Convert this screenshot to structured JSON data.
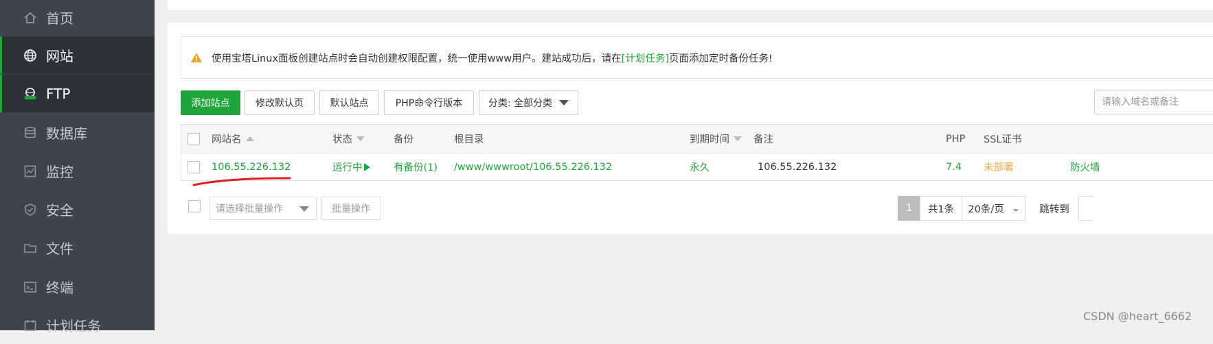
{
  "sidebar": {
    "items": [
      {
        "label": "首页",
        "icon": "home-icon",
        "active": false
      },
      {
        "label": "网站",
        "icon": "globe-icon",
        "active": true
      },
      {
        "label": "FTP",
        "icon": "ftp-icon",
        "active": true
      },
      {
        "label": "数据库",
        "icon": "database-icon",
        "active": false
      },
      {
        "label": "监控",
        "icon": "monitor-icon",
        "active": false
      },
      {
        "label": "安全",
        "icon": "shield-icon",
        "active": false
      },
      {
        "label": "文件",
        "icon": "folder-icon",
        "active": false
      },
      {
        "label": "终端",
        "icon": "terminal-icon",
        "active": false
      },
      {
        "label": "计划任务",
        "icon": "calendar-icon",
        "active": false
      }
    ]
  },
  "alert": {
    "text_before": "使用宝塔Linux面板创建站点时会自动创建权限配置，统一使用www用户。建站成功后，请在",
    "link": "[计划任务]",
    "text_after": "页面添加定时备份任务!"
  },
  "toolbar": {
    "add_site": "添加站点",
    "edit_default_page": "修改默认页",
    "default_site": "默认站点",
    "php_cli_version": "PHP命令行版本",
    "category": "分类: 全部分类",
    "search_placeholder": "请输入域名或备注"
  },
  "table": {
    "headers": {
      "site_name": "网站名",
      "status": "状态",
      "backup": "备份",
      "root": "根目录",
      "expire": "到期时间",
      "remark": "备注",
      "php": "PHP",
      "ssl": "SSL证书"
    },
    "rows": [
      {
        "site_name": "106.55.226.132",
        "status": "运行中",
        "backup": "有备份(1)",
        "root": "/www/wwwroot/106.55.226.132",
        "expire": "永久",
        "remark": "106.55.226.132",
        "php": "7.4",
        "ssl": "未部署",
        "firewall": "防火墙"
      }
    ]
  },
  "footer": {
    "batch_placeholder": "请选择批量操作",
    "batch_button": "批量操作",
    "current_page": "1",
    "total": "共1条",
    "per_page": "20条/页",
    "jump_label": "跳转到"
  },
  "watermark": "CSDN @heart_6662",
  "colors": {
    "sidebar_bg": "#3c444d",
    "sidebar_active_bg": "#2c3238",
    "accent_green": "#20a53a",
    "warning_orange": "#f0ad4e",
    "annotation_red": "#e02020"
  }
}
